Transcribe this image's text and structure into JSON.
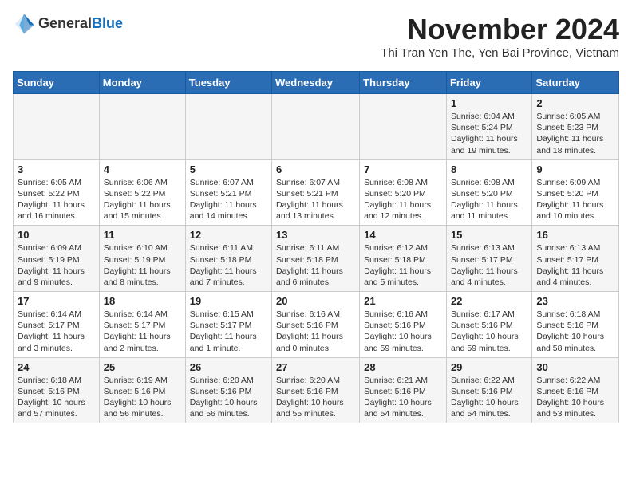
{
  "logo": {
    "general": "General",
    "blue": "Blue"
  },
  "header": {
    "month_title": "November 2024",
    "subtitle": "Thi Tran Yen The, Yen Bai Province, Vietnam"
  },
  "days_of_week": [
    "Sunday",
    "Monday",
    "Tuesday",
    "Wednesday",
    "Thursday",
    "Friday",
    "Saturday"
  ],
  "weeks": [
    {
      "cells": [
        {
          "day": "",
          "info": ""
        },
        {
          "day": "",
          "info": ""
        },
        {
          "day": "",
          "info": ""
        },
        {
          "day": "",
          "info": ""
        },
        {
          "day": "",
          "info": ""
        },
        {
          "day": "1",
          "info": "Sunrise: 6:04 AM\nSunset: 5:24 PM\nDaylight: 11 hours and 19 minutes."
        },
        {
          "day": "2",
          "info": "Sunrise: 6:05 AM\nSunset: 5:23 PM\nDaylight: 11 hours and 18 minutes."
        }
      ]
    },
    {
      "cells": [
        {
          "day": "3",
          "info": "Sunrise: 6:05 AM\nSunset: 5:22 PM\nDaylight: 11 hours and 16 minutes."
        },
        {
          "day": "4",
          "info": "Sunrise: 6:06 AM\nSunset: 5:22 PM\nDaylight: 11 hours and 15 minutes."
        },
        {
          "day": "5",
          "info": "Sunrise: 6:07 AM\nSunset: 5:21 PM\nDaylight: 11 hours and 14 minutes."
        },
        {
          "day": "6",
          "info": "Sunrise: 6:07 AM\nSunset: 5:21 PM\nDaylight: 11 hours and 13 minutes."
        },
        {
          "day": "7",
          "info": "Sunrise: 6:08 AM\nSunset: 5:20 PM\nDaylight: 11 hours and 12 minutes."
        },
        {
          "day": "8",
          "info": "Sunrise: 6:08 AM\nSunset: 5:20 PM\nDaylight: 11 hours and 11 minutes."
        },
        {
          "day": "9",
          "info": "Sunrise: 6:09 AM\nSunset: 5:20 PM\nDaylight: 11 hours and 10 minutes."
        }
      ]
    },
    {
      "cells": [
        {
          "day": "10",
          "info": "Sunrise: 6:09 AM\nSunset: 5:19 PM\nDaylight: 11 hours and 9 minutes."
        },
        {
          "day": "11",
          "info": "Sunrise: 6:10 AM\nSunset: 5:19 PM\nDaylight: 11 hours and 8 minutes."
        },
        {
          "day": "12",
          "info": "Sunrise: 6:11 AM\nSunset: 5:18 PM\nDaylight: 11 hours and 7 minutes."
        },
        {
          "day": "13",
          "info": "Sunrise: 6:11 AM\nSunset: 5:18 PM\nDaylight: 11 hours and 6 minutes."
        },
        {
          "day": "14",
          "info": "Sunrise: 6:12 AM\nSunset: 5:18 PM\nDaylight: 11 hours and 5 minutes."
        },
        {
          "day": "15",
          "info": "Sunrise: 6:13 AM\nSunset: 5:17 PM\nDaylight: 11 hours and 4 minutes."
        },
        {
          "day": "16",
          "info": "Sunrise: 6:13 AM\nSunset: 5:17 PM\nDaylight: 11 hours and 4 minutes."
        }
      ]
    },
    {
      "cells": [
        {
          "day": "17",
          "info": "Sunrise: 6:14 AM\nSunset: 5:17 PM\nDaylight: 11 hours and 3 minutes."
        },
        {
          "day": "18",
          "info": "Sunrise: 6:14 AM\nSunset: 5:17 PM\nDaylight: 11 hours and 2 minutes."
        },
        {
          "day": "19",
          "info": "Sunrise: 6:15 AM\nSunset: 5:17 PM\nDaylight: 11 hours and 1 minute."
        },
        {
          "day": "20",
          "info": "Sunrise: 6:16 AM\nSunset: 5:16 PM\nDaylight: 11 hours and 0 minutes."
        },
        {
          "day": "21",
          "info": "Sunrise: 6:16 AM\nSunset: 5:16 PM\nDaylight: 10 hours and 59 minutes."
        },
        {
          "day": "22",
          "info": "Sunrise: 6:17 AM\nSunset: 5:16 PM\nDaylight: 10 hours and 59 minutes."
        },
        {
          "day": "23",
          "info": "Sunrise: 6:18 AM\nSunset: 5:16 PM\nDaylight: 10 hours and 58 minutes."
        }
      ]
    },
    {
      "cells": [
        {
          "day": "24",
          "info": "Sunrise: 6:18 AM\nSunset: 5:16 PM\nDaylight: 10 hours and 57 minutes."
        },
        {
          "day": "25",
          "info": "Sunrise: 6:19 AM\nSunset: 5:16 PM\nDaylight: 10 hours and 56 minutes."
        },
        {
          "day": "26",
          "info": "Sunrise: 6:20 AM\nSunset: 5:16 PM\nDaylight: 10 hours and 56 minutes."
        },
        {
          "day": "27",
          "info": "Sunrise: 6:20 AM\nSunset: 5:16 PM\nDaylight: 10 hours and 55 minutes."
        },
        {
          "day": "28",
          "info": "Sunrise: 6:21 AM\nSunset: 5:16 PM\nDaylight: 10 hours and 54 minutes."
        },
        {
          "day": "29",
          "info": "Sunrise: 6:22 AM\nSunset: 5:16 PM\nDaylight: 10 hours and 54 minutes."
        },
        {
          "day": "30",
          "info": "Sunrise: 6:22 AM\nSunset: 5:16 PM\nDaylight: 10 hours and 53 minutes."
        }
      ]
    }
  ]
}
